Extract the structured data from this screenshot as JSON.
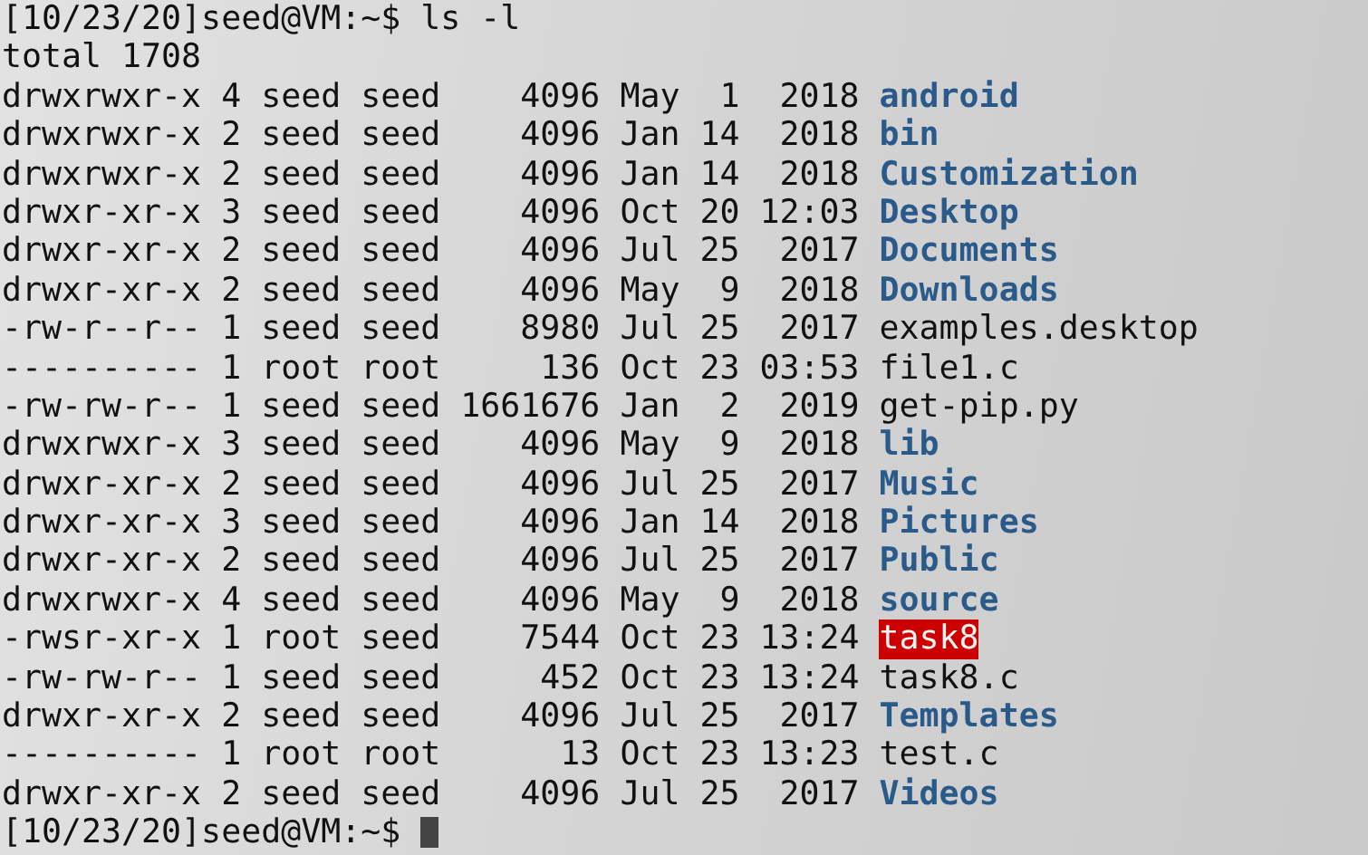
{
  "command_line": {
    "prompt": "[10/23/20]seed@VM:~$",
    "command": "ls -l"
  },
  "total": "total 1708",
  "entries": [
    {
      "info": "drwxrwxr-x 4 seed seed    4096 May  1  2018",
      "name": "android",
      "kind": "dir"
    },
    {
      "info": "drwxrwxr-x 2 seed seed    4096 Jan 14  2018",
      "name": "bin",
      "kind": "dir"
    },
    {
      "info": "drwxrwxr-x 2 seed seed    4096 Jan 14  2018",
      "name": "Customization",
      "kind": "dir"
    },
    {
      "info": "drwxr-xr-x 3 seed seed    4096 Oct 20 12:03",
      "name": "Desktop",
      "kind": "dir"
    },
    {
      "info": "drwxr-xr-x 2 seed seed    4096 Jul 25  2017",
      "name": "Documents",
      "kind": "dir"
    },
    {
      "info": "drwxr-xr-x 2 seed seed    4096 May  9  2018",
      "name": "Downloads",
      "kind": "dir"
    },
    {
      "info": "-rw-r--r-- 1 seed seed    8980 Jul 25  2017",
      "name": "examples.desktop",
      "kind": "file"
    },
    {
      "info": "---------- 1 root root     136 Oct 23 03:53",
      "name": "file1.c",
      "kind": "file"
    },
    {
      "info": "-rw-rw-r-- 1 seed seed 1661676 Jan  2  2019",
      "name": "get-pip.py",
      "kind": "file"
    },
    {
      "info": "drwxrwxr-x 3 seed seed    4096 May  9  2018",
      "name": "lib",
      "kind": "dir"
    },
    {
      "info": "drwxr-xr-x 2 seed seed    4096 Jul 25  2017",
      "name": "Music",
      "kind": "dir"
    },
    {
      "info": "drwxr-xr-x 3 seed seed    4096 Jan 14  2018",
      "name": "Pictures",
      "kind": "dir"
    },
    {
      "info": "drwxr-xr-x 2 seed seed    4096 Jul 25  2017",
      "name": "Public",
      "kind": "dir"
    },
    {
      "info": "drwxrwxr-x 4 seed seed    4096 May  9  2018",
      "name": "source",
      "kind": "dir"
    },
    {
      "info": "-rwsr-xr-x 1 root seed    7544 Oct 23 13:24",
      "name": "task8",
      "kind": "setuid"
    },
    {
      "info": "-rw-rw-r-- 1 seed seed     452 Oct 23 13:24",
      "name": "task8.c",
      "kind": "file"
    },
    {
      "info": "drwxr-xr-x 2 seed seed    4096 Jul 25  2017",
      "name": "Templates",
      "kind": "dir"
    },
    {
      "info": "---------- 1 root root      13 Oct 23 13:23",
      "name": "test.c",
      "kind": "file"
    },
    {
      "info": "drwxr-xr-x 2 seed seed    4096 Jul 25  2017",
      "name": "Videos",
      "kind": "dir"
    }
  ],
  "next_prompt": "[10/23/20]seed@VM:~$"
}
